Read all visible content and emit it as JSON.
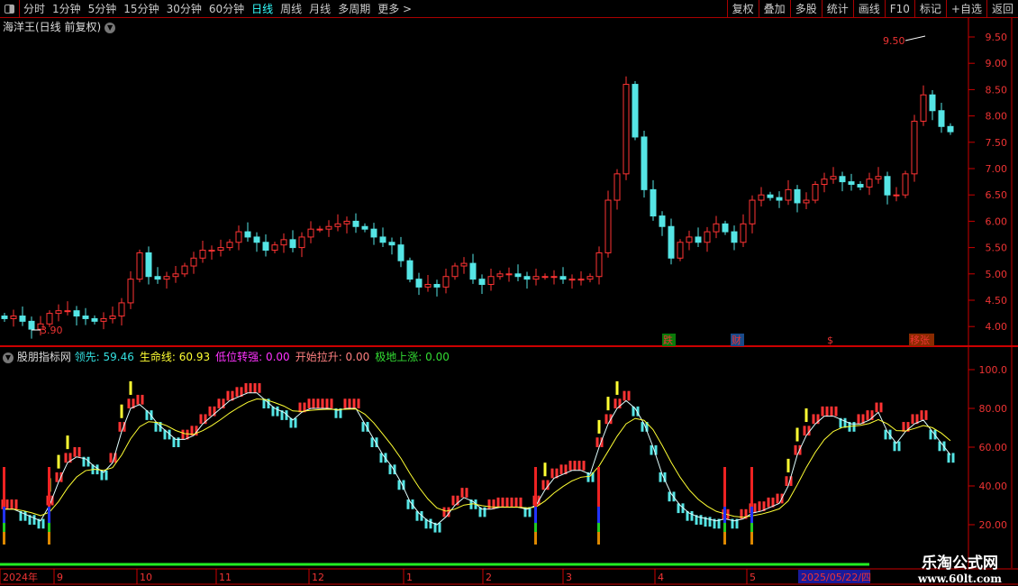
{
  "toolbar": {
    "periods": [
      "分时",
      "1分钟",
      "5分钟",
      "15分钟",
      "30分钟",
      "60分钟",
      "日线",
      "周线",
      "月线",
      "多周期",
      "更多 >"
    ],
    "active": "日线",
    "tools": [
      "复权",
      "叠加",
      "多股",
      "统计",
      "画线",
      "F10",
      "标记",
      "+自选",
      "返回"
    ]
  },
  "title": "海洋王(日线 前复权)",
  "indicator": {
    "name": "股朋指标网",
    "items": [
      {
        "label": "领先: ",
        "value": "59.46",
        "color": "#33e0e0"
      },
      {
        "label": "生命线: ",
        "value": "60.93",
        "color": "#ffff33"
      },
      {
        "label": "低位转强: ",
        "value": "0.00",
        "color": "#ff33ff"
      },
      {
        "label": "开始拉升: ",
        "value": "0.00",
        "color": "#ff8080"
      },
      {
        "label": "极地上涨: ",
        "value": "0.00",
        "color": "#33dd33"
      }
    ]
  },
  "price_labels": {
    "high": "9.50",
    "low": "3.90"
  },
  "signals": [
    {
      "text": "跌",
      "bg": "#0a7a0a"
    },
    {
      "text": "财",
      "bg": "#1a4a8a"
    },
    {
      "text": "$",
      "bg": "none"
    },
    {
      "text": "移张",
      "bg": "#8a2a00"
    }
  ],
  "date_axis": {
    "labels": [
      "2024年",
      "9",
      "10",
      "11",
      "12",
      "1",
      "2",
      "3",
      "4",
      "5"
    ],
    "cursor_date": "2025/05/22/四"
  },
  "watermark": {
    "line1": "乐淘公式网",
    "line2": "www.60lt.com"
  },
  "colors": {
    "up": "#ff3333",
    "down": "#55e5e5",
    "axis": "#cc0000",
    "lifeline": "#ffff33"
  },
  "chart_data": [
    {
      "type": "candlestick",
      "yaxis_ticks": [
        "9.50",
        "9.00",
        "8.50",
        "8.00",
        "7.50",
        "7.00",
        "6.50",
        "6.00",
        "5.50",
        "5.00",
        "4.50",
        "4.00"
      ],
      "ylim": [
        4.0,
        9.5
      ],
      "closes": [
        4.15,
        4.2,
        4.1,
        3.95,
        4.05,
        4.25,
        4.3,
        4.3,
        4.2,
        4.15,
        4.1,
        4.15,
        4.2,
        4.45,
        4.9,
        5.4,
        4.95,
        4.9,
        4.95,
        5.0,
        5.15,
        5.3,
        5.45,
        5.45,
        5.5,
        5.6,
        5.8,
        5.7,
        5.6,
        5.45,
        5.55,
        5.65,
        5.5,
        5.7,
        5.85,
        5.85,
        5.9,
        5.95,
        6.0,
        5.9,
        5.85,
        5.7,
        5.6,
        5.55,
        5.25,
        4.9,
        4.75,
        4.8,
        4.75,
        4.95,
        5.15,
        5.2,
        4.9,
        4.8,
        4.95,
        5.0,
        5.0,
        4.95,
        4.9,
        4.95,
        4.95,
        4.95,
        4.9,
        4.9,
        4.9,
        4.95,
        5.4,
        6.4,
        6.9,
        8.6,
        7.6,
        6.6,
        6.1,
        5.9,
        5.3,
        5.6,
        5.7,
        5.6,
        5.8,
        5.95,
        5.8,
        5.6,
        5.95,
        6.4,
        6.5,
        6.45,
        6.4,
        6.6,
        6.35,
        6.4,
        6.7,
        6.8,
        6.85,
        6.75,
        6.7,
        6.65,
        6.8,
        6.85,
        6.5,
        6.5,
        6.9,
        7.9,
        8.4,
        8.1,
        7.8,
        7.7
      ]
    },
    {
      "type": "line+bar",
      "yaxis_ticks": [
        "100.0",
        "80.00",
        "60.00",
        "40.00",
        "20.00"
      ],
      "ylim": [
        20,
        100
      ],
      "lead": [
        28,
        28,
        26,
        24,
        22,
        30,
        42,
        52,
        55,
        54,
        50,
        47,
        52,
        68,
        80,
        82,
        78,
        72,
        68,
        64,
        64,
        66,
        72,
        76,
        80,
        84,
        86,
        88,
        88,
        84,
        80,
        78,
        74,
        78,
        80,
        80,
        80,
        79,
        80,
        80,
        72,
        64,
        56,
        50,
        42,
        32,
        26,
        22,
        20,
        24,
        30,
        34,
        32,
        28,
        28,
        29,
        29,
        29,
        28,
        30,
        38,
        44,
        46,
        48,
        48,
        46,
        60,
        72,
        80,
        84,
        80,
        72,
        60,
        46,
        36,
        30,
        26,
        24,
        23,
        22,
        23,
        22,
        23,
        26,
        27,
        29,
        31,
        40,
        56,
        66,
        72,
        76,
        76,
        74,
        72,
        72,
        74,
        78,
        68,
        62,
        68,
        72,
        74,
        68,
        62,
        56
      ],
      "signal_bar_indices": [
        0,
        5,
        59,
        66,
        80,
        83
      ]
    }
  ]
}
